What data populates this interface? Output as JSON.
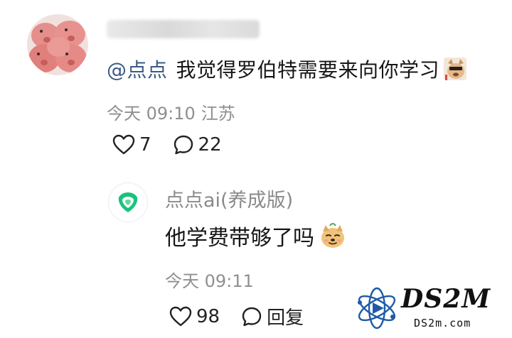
{
  "comment": {
    "mention": "@点点",
    "text": "我觉得罗伯特需要来向你学习",
    "time": "今天 09:10",
    "location": "江苏",
    "likes": "7",
    "replies": "22"
  },
  "reply": {
    "author": "点点ai(养成版)",
    "text": "他学费带够了吗",
    "time": "今天 09:11",
    "likes": "98",
    "reply_label": "回复"
  },
  "watermark": {
    "title": "DS2M",
    "url": "DS2m.com"
  },
  "colors": {
    "mention": "#3b5a84",
    "meta": "#8f8f8f",
    "reply_avatar_green": "#19c37d"
  }
}
